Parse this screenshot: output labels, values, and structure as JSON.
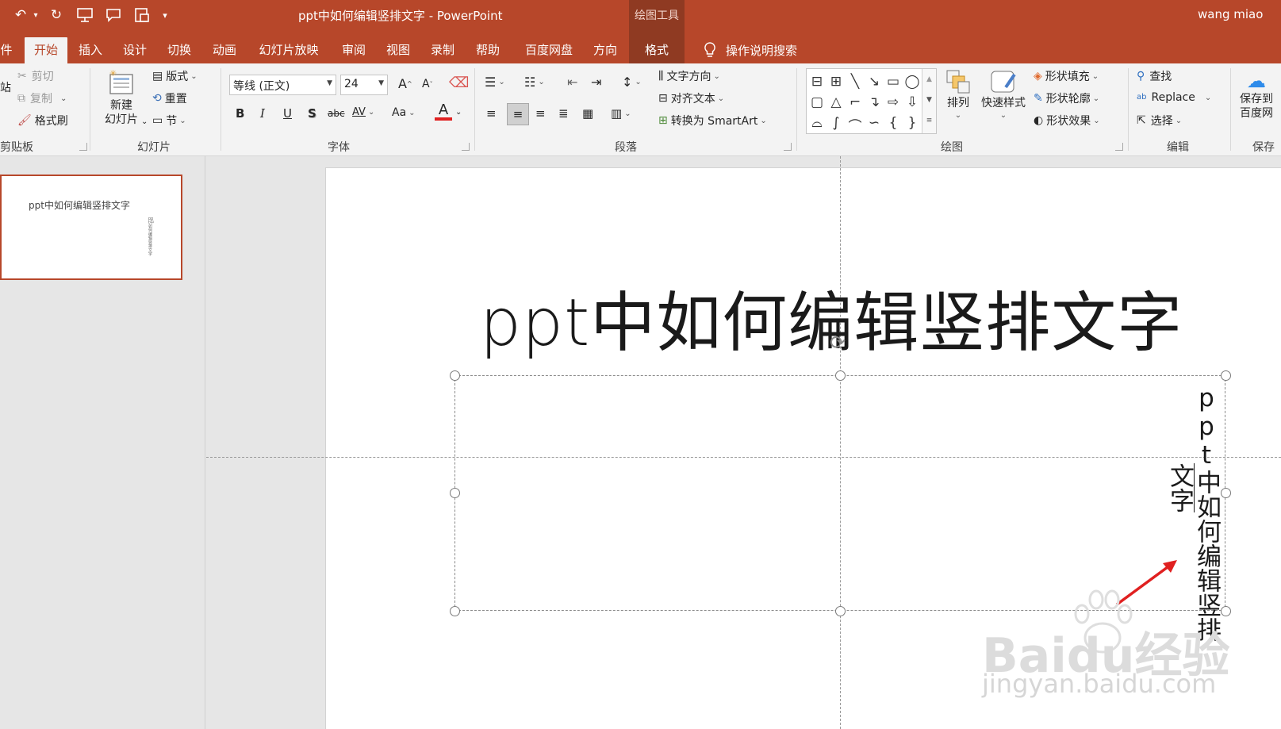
{
  "titlebar": {
    "title": "ppt中如何编辑竖排文字 - PowerPoint",
    "context_group": "绘图工具",
    "user": "wang miao",
    "qat_more": "▾"
  },
  "tabs": {
    "file_fragment": "件",
    "items": [
      "开始",
      "插入",
      "设计",
      "切换",
      "动画",
      "幻灯片放映",
      "审阅",
      "视图",
      "录制",
      "帮助",
      "百度网盘",
      "方向",
      "格式"
    ],
    "tell_me": "操作说明搜索"
  },
  "ribbon": {
    "clipboard": {
      "paste_fragment": "站",
      "cut": "剪切",
      "copy": "复制",
      "format_painter": "格式刷",
      "label": "剪贴板"
    },
    "slides": {
      "new_slide_line1": "新建",
      "new_slide_line2": "幻灯片",
      "layout": "版式",
      "reset": "重置",
      "section": "节",
      "label": "幻灯片"
    },
    "font": {
      "font_name": "等线 (正文)",
      "font_size": "24",
      "grow": "A",
      "shrink": "A",
      "bold": "B",
      "italic": "I",
      "underline": "U",
      "shadow": "S",
      "strike": "abc",
      "spacing": "AV",
      "case": "Aa",
      "color": "A",
      "label": "字体"
    },
    "paragraph": {
      "text_direction": "文字方向",
      "align_text": "对齐文本",
      "convert_smartart": "转换为 SmartArt",
      "label": "段落"
    },
    "drawing": {
      "arrange": "排列",
      "quick_styles": "快速样式",
      "shape_fill": "形状填充",
      "shape_outline": "形状轮廓",
      "shape_effects": "形状效果",
      "label": "绘图"
    },
    "editing": {
      "find": "查找",
      "replace": "Replace",
      "select": "选择",
      "label": "编辑"
    },
    "save": {
      "line1": "保存到",
      "line2": "百度网",
      "label": "保存"
    }
  },
  "thumbnail": {
    "title": "ppt中如何编辑竖排文字",
    "vertical": "ppt中如何编辑竖排文字"
  },
  "slide": {
    "title": "ppt中如何编辑竖排文字",
    "vertical_col1": "ppt中如何编辑竖排",
    "vertical_col2": "文字"
  },
  "watermark": {
    "main": "Baidu经验",
    "sub": "jingyan.baidu.com"
  },
  "colors": {
    "accent": "#b7472a",
    "annotation_arrow": "#e02020"
  }
}
